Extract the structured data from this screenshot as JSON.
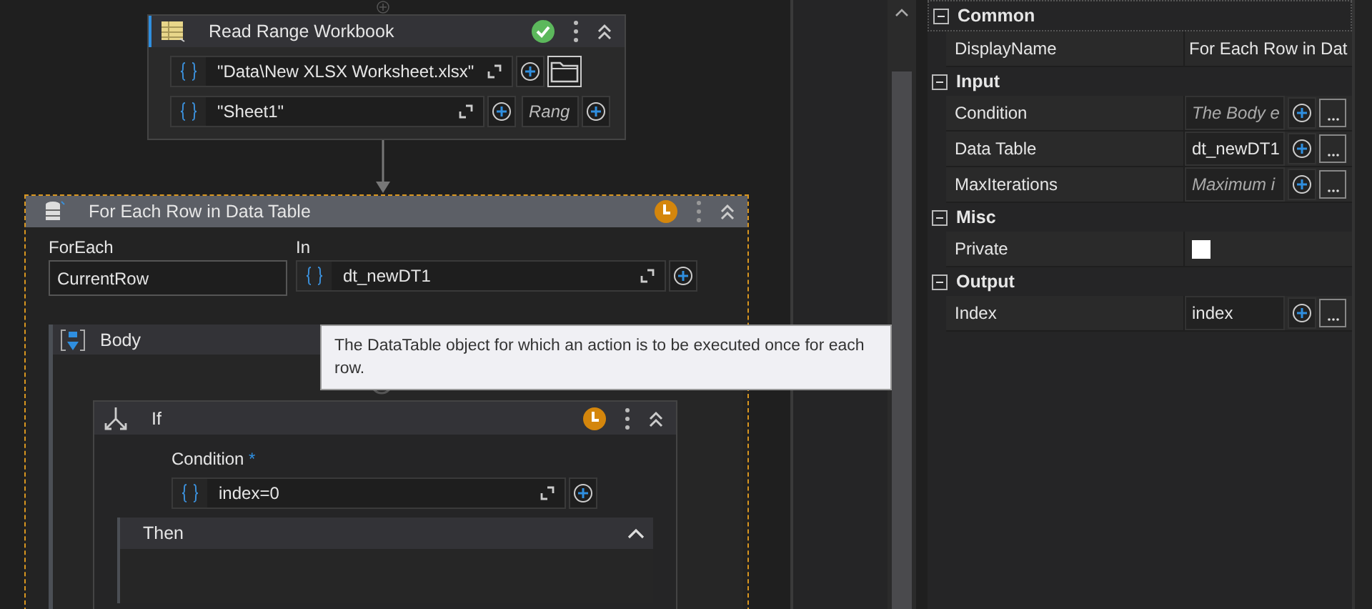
{
  "read_range": {
    "title": "Read Range Workbook",
    "valid": true,
    "workbook_path": "\"Data\\New XLSX Worksheet.xlsx\"",
    "sheet_name": "\"Sheet1\"",
    "range_placeholder": "Rang"
  },
  "for_each": {
    "title": "For Each Row in Data Table",
    "valid": false,
    "selected": true,
    "foreach_label": "ForEach",
    "foreach_value": "CurrentRow",
    "in_label": "In",
    "in_value": "dt_newDT1",
    "body": {
      "title": "Body",
      "if": {
        "title": "If",
        "valid": false,
        "condition_label": "Condition",
        "required_mark": "*",
        "condition_value": "index=0",
        "then": {
          "title": "Then"
        }
      }
    }
  },
  "tooltip": "The DataTable object for which an action is to be executed once for each row.",
  "properties": [
    {
      "name": "Common",
      "expanded": true,
      "items": [
        {
          "kind": "text",
          "name": "DisplayName",
          "value": "For Each Row in Dat"
        }
      ]
    },
    {
      "name": "Input",
      "expanded": true,
      "items": [
        {
          "kind": "expression",
          "name": "Condition",
          "placeholder": "The Body e"
        },
        {
          "kind": "expression",
          "name": "Data Table",
          "value": "dt_newDT1"
        },
        {
          "kind": "expression",
          "name": "MaxIterations",
          "placeholder": "Maximum i"
        }
      ]
    },
    {
      "name": "Misc",
      "expanded": true,
      "items": [
        {
          "kind": "checkbox",
          "name": "Private",
          "checked": false
        }
      ]
    },
    {
      "name": "Output",
      "expanded": true,
      "items": [
        {
          "kind": "expression",
          "name": "Index",
          "value": "index"
        }
      ]
    }
  ]
}
